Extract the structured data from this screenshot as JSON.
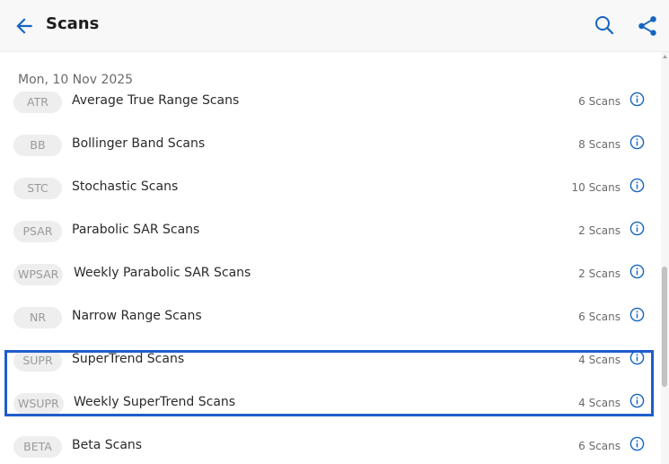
{
  "header": {
    "title": "Scans",
    "back_icon": "arrow-left-icon",
    "search_icon": "search-icon",
    "share_icon": "share-icon",
    "accent_color": "#1565c0"
  },
  "list": {
    "date_label": "Mon, 10 Nov 2025",
    "items": [
      {
        "badge": "ATR",
        "name": "Average True Range Scans",
        "count": "6 Scans"
      },
      {
        "badge": "BB",
        "name": "Bollinger Band Scans",
        "count": "8 Scans"
      },
      {
        "badge": "STC",
        "name": "Stochastic Scans",
        "count": "10 Scans"
      },
      {
        "badge": "PSAR",
        "name": "Parabolic SAR Scans",
        "count": "2 Scans"
      },
      {
        "badge": "WPSAR",
        "name": "Weekly Parabolic SAR Scans",
        "count": "2 Scans"
      },
      {
        "badge": "NR",
        "name": "Narrow Range Scans",
        "count": "6 Scans"
      },
      {
        "badge": "SUPR",
        "name": "SuperTrend Scans",
        "count": "4 Scans"
      },
      {
        "badge": "WSUPR",
        "name": "Weekly SuperTrend Scans",
        "count": "4 Scans"
      },
      {
        "badge": "BETA",
        "name": "Beta Scans",
        "count": "6 Scans"
      }
    ],
    "info_icon": "info-circle-icon",
    "highlighted_items": [
      "SuperTrend Scans",
      "Weekly SuperTrend Scans"
    ],
    "highlight_color": "#1f5dcc"
  }
}
